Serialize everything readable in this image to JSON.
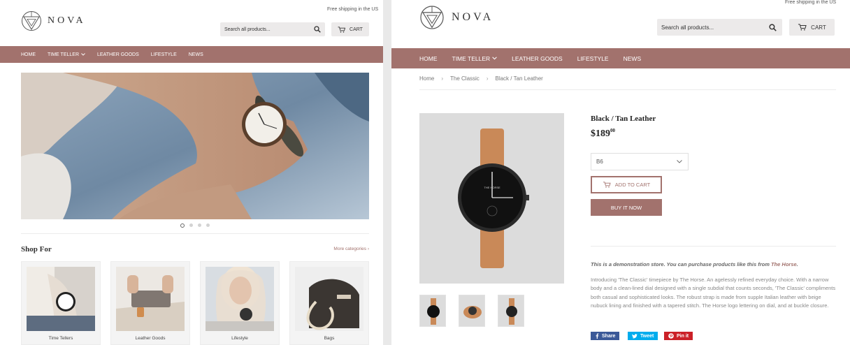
{
  "colors": {
    "brand": "#a2726d",
    "nav_text": "#ffffff",
    "search_bg": "#eceaea"
  },
  "left": {
    "logo_text": "NOVA",
    "shipping_note": "Free shipping in the US",
    "search_placeholder": "Search all products...",
    "cart_label": "CART",
    "nav": [
      "HOME",
      "TIME TELLER",
      "LEATHER GOODS",
      "LIFESTYLE",
      "NEWS"
    ],
    "slideshow": {
      "slides": 4,
      "active": 1
    },
    "shop_for_title": "Shop For",
    "more_categories": "More categories ›",
    "categories": [
      "Time Tellers",
      "Leather Goods",
      "Lifestyle",
      "Bags"
    ]
  },
  "right": {
    "logo_text": "NOVA",
    "shipping_note": "Free shipping in the US",
    "search_placeholder": "Search all products...",
    "cart_label": "CART",
    "nav": [
      "HOME",
      "TIME TELLER",
      "LEATHER GOODS",
      "LIFESTYLE",
      "NEWS"
    ],
    "breadcrumb": [
      "Home",
      "The Classic",
      "Black / Tan Leather"
    ],
    "breadcrumb_sep": "›",
    "product_title": "Black / Tan Leather",
    "price_main": "$189",
    "price_cents": "00",
    "variant_selected": "B6",
    "add_to_cart": "ADD TO CART",
    "buy_now": "BUY IT NOW",
    "watch_brand_text": "THE HORSE",
    "demo_prefix": "This is a demonstration store. You can purchase products like this from ",
    "demo_link": "The Horse",
    "demo_suffix": ".",
    "description": "Introducing 'The Classic' timepiece by The Horse. An agelessly refined everyday choice. With a narrow body and a clean-lined dial designed with a single subdial that counts seconds, 'The Classic' compliments both casual and sophisticated looks. The robust strap is made from supple Italian leather with beige nubuck lining and finished with a tapered stitch. The Horse logo lettering on dial, and at buckle closure.",
    "share": [
      {
        "label": "Share",
        "icon": "facebook-icon",
        "color": "#3b5998"
      },
      {
        "label": "Tweet",
        "icon": "twitter-icon",
        "color": "#00aced"
      },
      {
        "label": "Pin it",
        "icon": "pinterest-icon",
        "color": "#cb2027"
      }
    ]
  }
}
